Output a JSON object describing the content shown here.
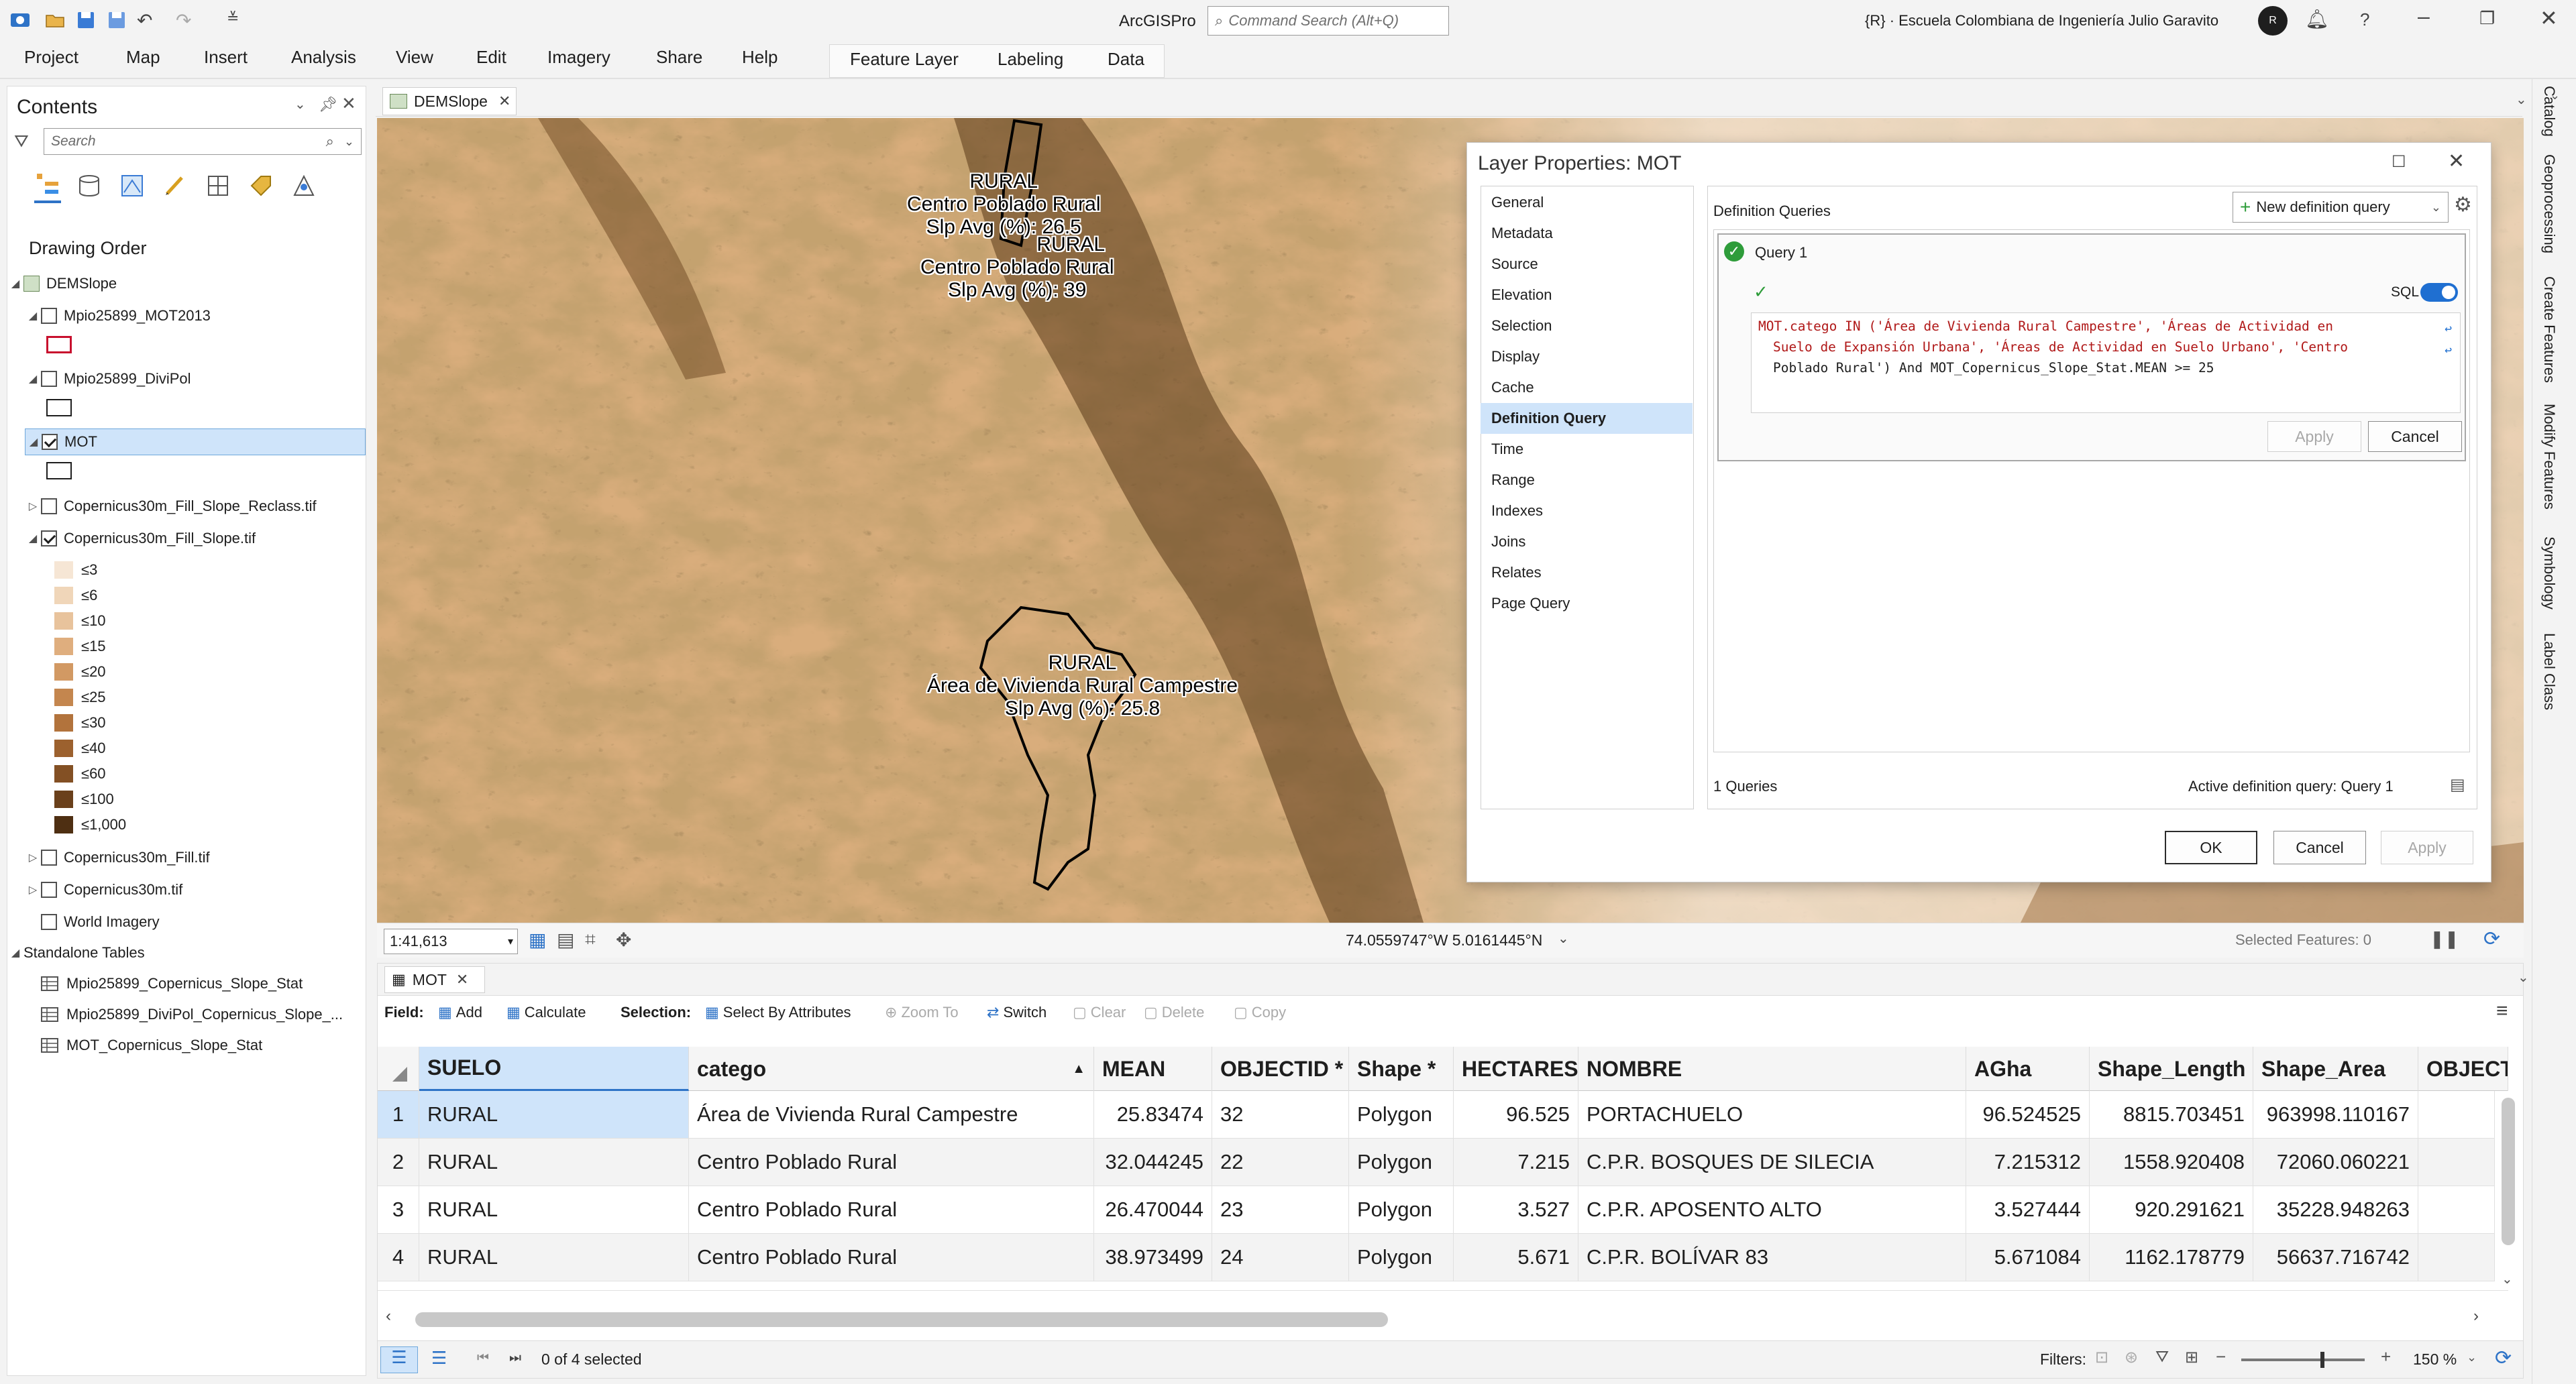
{
  "app": {
    "title": "ArcGISPro",
    "command_search_placeholder": "Command Search (Alt+Q)",
    "org": "{R} · Escuela Colombiana de Ingeniería Julio Garavito",
    "avatar": "R"
  },
  "ribbon": {
    "tabs": [
      "Project",
      "Map",
      "Insert",
      "Analysis",
      "View",
      "Edit",
      "Imagery",
      "Share",
      "Help"
    ],
    "contextual_tabs": [
      "Feature Layer",
      "Labeling",
      "Data"
    ]
  },
  "contents": {
    "title": "Contents",
    "search_placeholder": "Search",
    "drawing_order": "Drawing Order",
    "map_name": "DEMSlope",
    "layers": [
      {
        "name": "Mpio25899_MOT2013",
        "checked": false
      },
      {
        "name": "Mpio25899_DiviPol",
        "checked": false
      },
      {
        "name": "MOT",
        "checked": true
      },
      {
        "name": "Copernicus30m_Fill_Slope_Reclass.tif",
        "checked": false
      },
      {
        "name": "Copernicus30m_Fill_Slope.tif",
        "checked": true
      }
    ],
    "legend": [
      {
        "label": "≤3",
        "color": "#f6e6d5"
      },
      {
        "label": "≤6",
        "color": "#f0d6b9"
      },
      {
        "label": "≤10",
        "color": "#e8c39c"
      },
      {
        "label": "≤15",
        "color": "#dfae7e"
      },
      {
        "label": "≤20",
        "color": "#d29963"
      },
      {
        "label": "≤25",
        "color": "#c4864e"
      },
      {
        "label": "≤30",
        "color": "#b2733c"
      },
      {
        "label": "≤40",
        "color": "#9c612e"
      },
      {
        "label": "≤60",
        "color": "#835024"
      },
      {
        "label": "≤100",
        "color": "#6a401b"
      },
      {
        "label": "≤1,000",
        "color": "#4e2f12"
      }
    ],
    "other_layers": [
      {
        "name": "Copernicus30m_Fill.tif",
        "checked": false
      },
      {
        "name": "Copernicus30m.tif",
        "checked": false
      },
      {
        "name": "World Imagery",
        "checked": false
      }
    ],
    "standalone_tables_title": "Standalone Tables",
    "standalone_tables": [
      "Mpio25899_Copernicus_Slope_Stat",
      "Mpio25899_DiviPol_Copernicus_Slope_...",
      "MOT_Copernicus_Slope_Stat"
    ]
  },
  "map": {
    "tab": "DEMSlope",
    "scale": "1:41,613",
    "coordinates": "74.0559747°W 5.0161445°N",
    "selected_features": "Selected Features: 0",
    "labels": [
      {
        "l1": "RURAL",
        "l2": "Centro Poblado Rural",
        "l3": "Slp Avg (%): 26.5"
      },
      {
        "l1": "RURAL",
        "l2": "Centro Poblado Rural",
        "l3": "Slp Avg (%): 39"
      },
      {
        "l1": "RURAL",
        "l2": "Área de Vivienda Rural Campestre",
        "l3": "Slp Avg (%): 25.8"
      }
    ]
  },
  "dialog": {
    "title": "Layer Properties: MOT",
    "nav": [
      "General",
      "Metadata",
      "Source",
      "Elevation",
      "Selection",
      "Display",
      "Cache",
      "Definition Query",
      "Time",
      "Range",
      "Indexes",
      "Joins",
      "Relates",
      "Page Query"
    ],
    "active_nav": "Definition Query",
    "section_title": "Definition Queries",
    "new_query_button": "New definition query",
    "query_name": "Query 1",
    "sql_label": "SQL",
    "sql_line1": "MOT.catego IN ('Área de Vivienda Rural Campestre', 'Áreas de Actividad en",
    "sql_line2": "Suelo de Expansión Urbana', 'Áreas de Actividad en Suelo Urbano', 'Centro",
    "sql_line3": "Poblado Rural') And MOT_Copernicus_Slope_Stat.MEAN >= 25",
    "query_apply": "Apply",
    "query_cancel": "Cancel",
    "queries_count": "1 Queries",
    "active_query": "Active definition query: Query 1",
    "ok": "OK",
    "cancel": "Cancel",
    "apply": "Apply"
  },
  "table": {
    "tab": "MOT",
    "toolbar": {
      "field_label": "Field:",
      "add": "Add",
      "calculate": "Calculate",
      "selection_label": "Selection:",
      "select_by_attributes": "Select By Attributes",
      "zoom_to": "Zoom To",
      "switch": "Switch",
      "clear": "Clear",
      "delete": "Delete",
      "copy": "Copy"
    },
    "columns": [
      "SUELO",
      "catego",
      "MEAN",
      "OBJECTID *",
      "Shape *",
      "HECTARES",
      "NOMBRE",
      "AGha",
      "Shape_Length",
      "Shape_Area",
      "OBJECT"
    ],
    "rows": [
      {
        "n": "1",
        "SUELO": "RURAL",
        "catego": "Área de Vivienda Rural Campestre",
        "MEAN": "25.83474",
        "OBJECTID": "32",
        "Shape": "Polygon",
        "HECTARES": "96.525",
        "NOMBRE": "PORTACHUELO",
        "AGha": "96.524525",
        "Shape_Length": "8815.703451",
        "Shape_Area": "963998.110167"
      },
      {
        "n": "2",
        "SUELO": "RURAL",
        "catego": "Centro Poblado Rural",
        "MEAN": "32.044245",
        "OBJECTID": "22",
        "Shape": "Polygon",
        "HECTARES": "7.215",
        "NOMBRE": "C.P.R. BOSQUES DE SILECIA",
        "AGha": "7.215312",
        "Shape_Length": "1558.920408",
        "Shape_Area": "72060.060221"
      },
      {
        "n": "3",
        "SUELO": "RURAL",
        "catego": "Centro Poblado Rural",
        "MEAN": "26.470044",
        "OBJECTID": "23",
        "Shape": "Polygon",
        "HECTARES": "3.527",
        "NOMBRE": "C.P.R. APOSENTO ALTO",
        "AGha": "3.527444",
        "Shape_Length": "920.291621",
        "Shape_Area": "35228.948263"
      },
      {
        "n": "4",
        "SUELO": "RURAL",
        "catego": "Centro Poblado Rural",
        "MEAN": "38.973499",
        "OBJECTID": "24",
        "Shape": "Polygon",
        "HECTARES": "5.671",
        "NOMBRE": "C.P.R. BOLÍVAR 83",
        "AGha": "5.671084",
        "Shape_Length": "1162.178779",
        "Shape_Area": "56637.716742"
      }
    ],
    "status": "0 of 4 selected",
    "filters_label": "Filters:",
    "zoom": "150 %"
  },
  "right_tabs": [
    "Catalog",
    "Geoprocessing",
    "Create Features",
    "Modify Features",
    "Symbology",
    "Label Class"
  ]
}
